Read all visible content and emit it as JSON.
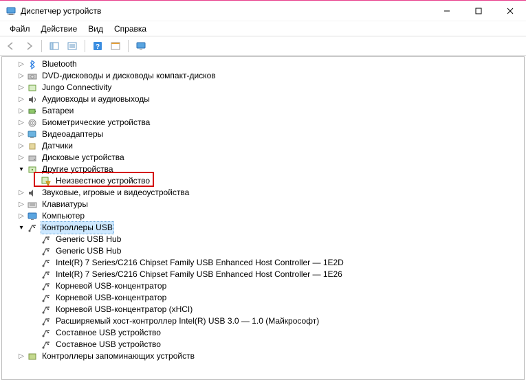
{
  "window": {
    "title": "Диспетчер устройств"
  },
  "menu": {
    "file": "Файл",
    "action": "Действие",
    "view": "Вид",
    "help": "Справка"
  },
  "tree": {
    "bluetooth": "Bluetooth",
    "dvd": "DVD-дисководы и дисководы компакт-дисков",
    "jungo": "Jungo Connectivity",
    "audio": "Аудиовходы и аудиовыходы",
    "battery": "Батареи",
    "biometric": "Биометрические устройства",
    "video": "Видеоадаптеры",
    "sensors": "Датчики",
    "disk": "Дисковые устройства",
    "other": "Другие устройства",
    "unknown": "Неизвестное устройство",
    "sound": "Звуковые, игровые и видеоустройства",
    "keyboard": "Клавиатуры",
    "computer": "Компьютер",
    "usb": "Контроллеры USB",
    "usb_items": [
      "Generic USB Hub",
      "Generic USB Hub",
      "Intel(R) 7 Series/C216 Chipset Family USB Enhanced Host Controller — 1E2D",
      "Intel(R) 7 Series/C216 Chipset Family USB Enhanced Host Controller — 1E26",
      "Корневой USB-концентратор",
      "Корневой USB-концентратор",
      "Корневой USB-концентратор (xHCI)",
      "Расширяемый хост-контроллер Intel(R) USB 3.0 — 1.0 (Майкрософт)",
      "Составное USB устройство",
      "Составное USB устройство"
    ],
    "storagectl": "Контроллеры запоминающих устройств"
  }
}
